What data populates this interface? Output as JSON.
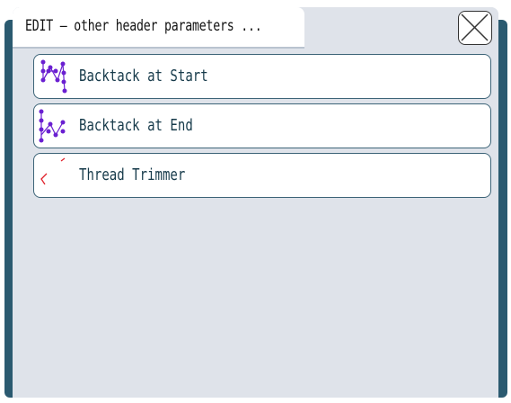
{
  "window": {
    "title": "EDIT – other header parameters ...",
    "close_icon": "close-x-icon"
  },
  "menu": {
    "items": [
      {
        "label": "Backtack at Start",
        "icon": "backtack-start-icon"
      },
      {
        "label": "Backtack at End",
        "icon": "backtack-end-icon"
      },
      {
        "label": "Thread Trimmer",
        "icon": "thread-trimmer-icon"
      }
    ]
  },
  "colors": {
    "frame": "#2b5a70",
    "window_bg": "#dfe3ea",
    "item_border": "#3d6478",
    "icon_stitch": "#6a1fd1",
    "icon_trim": "#e0202a"
  }
}
